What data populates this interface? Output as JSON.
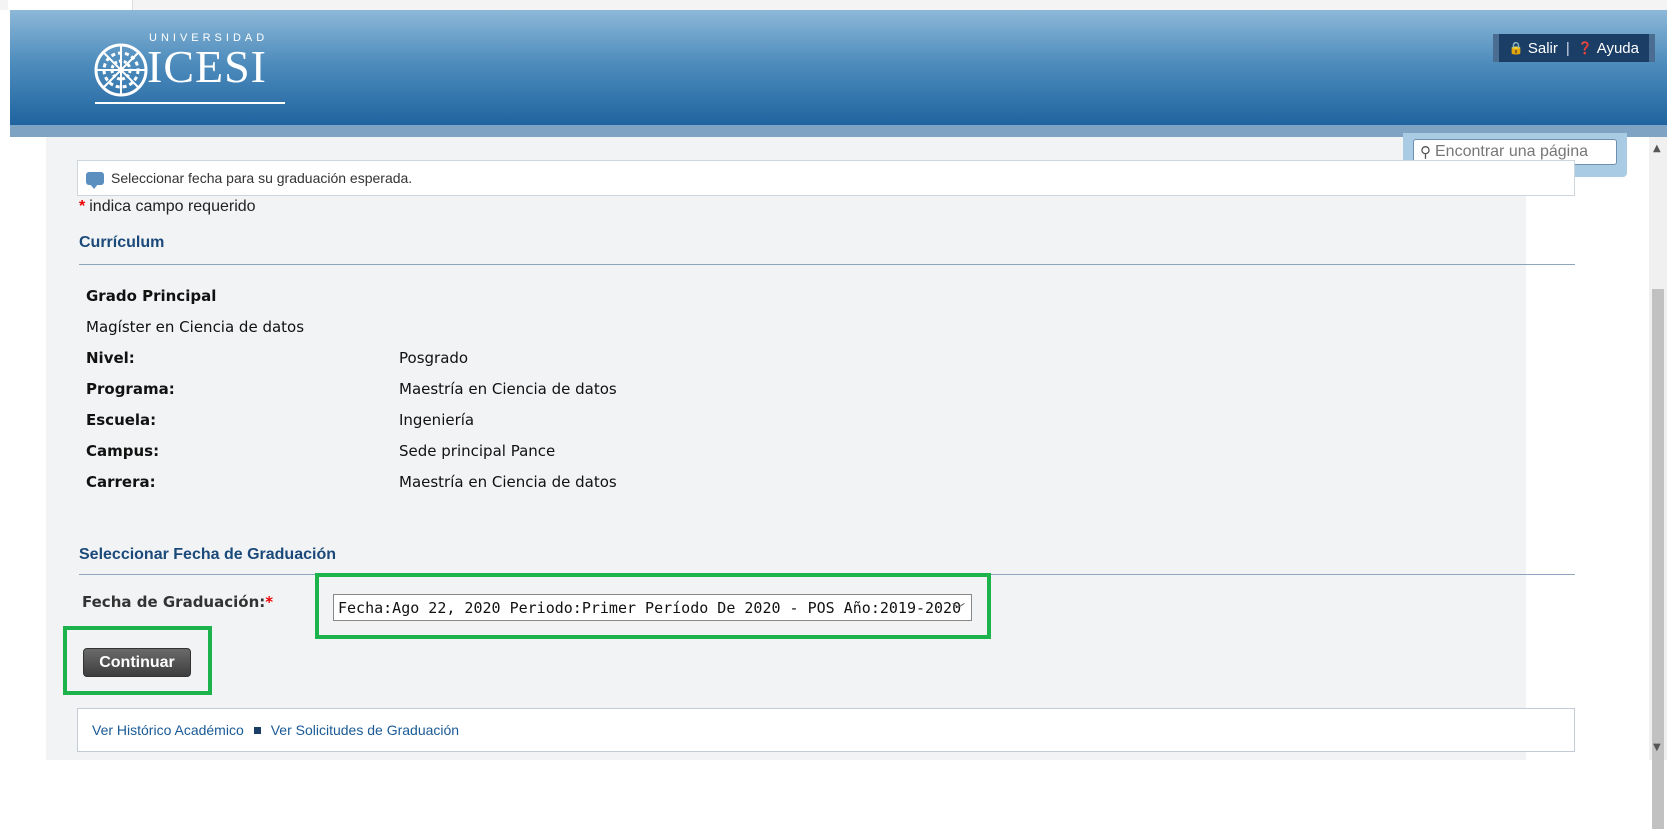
{
  "header": {
    "logo_top": "UNIVERSIDAD",
    "logo_name": "ICESI",
    "links": {
      "salir": "Salir",
      "separator": "|",
      "ayuda": "Ayuda"
    }
  },
  "search": {
    "placeholder": "Encontrar una página"
  },
  "info": {
    "message": "Seleccionar fecha para su graduación esperada."
  },
  "required_note": {
    "star": "*",
    "text": "indica campo requerido"
  },
  "curriculum": {
    "title": "Currículum",
    "degree_label": "Grado Principal",
    "degree_value": "Magíster en Ciencia de datos",
    "rows": [
      {
        "label": "Nivel:",
        "value": "Posgrado"
      },
      {
        "label": "Programa:",
        "value": "Maestría en Ciencia de datos"
      },
      {
        "label": "Escuela:",
        "value": "Ingeniería"
      },
      {
        "label": "Campus:",
        "value": "Sede principal Pance"
      },
      {
        "label": "Carrera:",
        "value": "Maestría en Ciencia de datos"
      }
    ]
  },
  "graduation": {
    "title": "Seleccionar Fecha de Graduación",
    "field_label": "Fecha de Graduación:",
    "required_star": "*",
    "selected_option": "Fecha:Ago 22, 2020 Periodo:Primer Período De 2020 - POS Año:2019-2020",
    "continue_label": "Continuar"
  },
  "footer": {
    "links": [
      "Ver Histórico Académico",
      "Ver Solicitudes de Graduación"
    ]
  },
  "colors": {
    "highlight": "#1db34c",
    "header_dark": "#1f64a0",
    "section_title": "#1b4a7a",
    "required": "#e00000"
  }
}
